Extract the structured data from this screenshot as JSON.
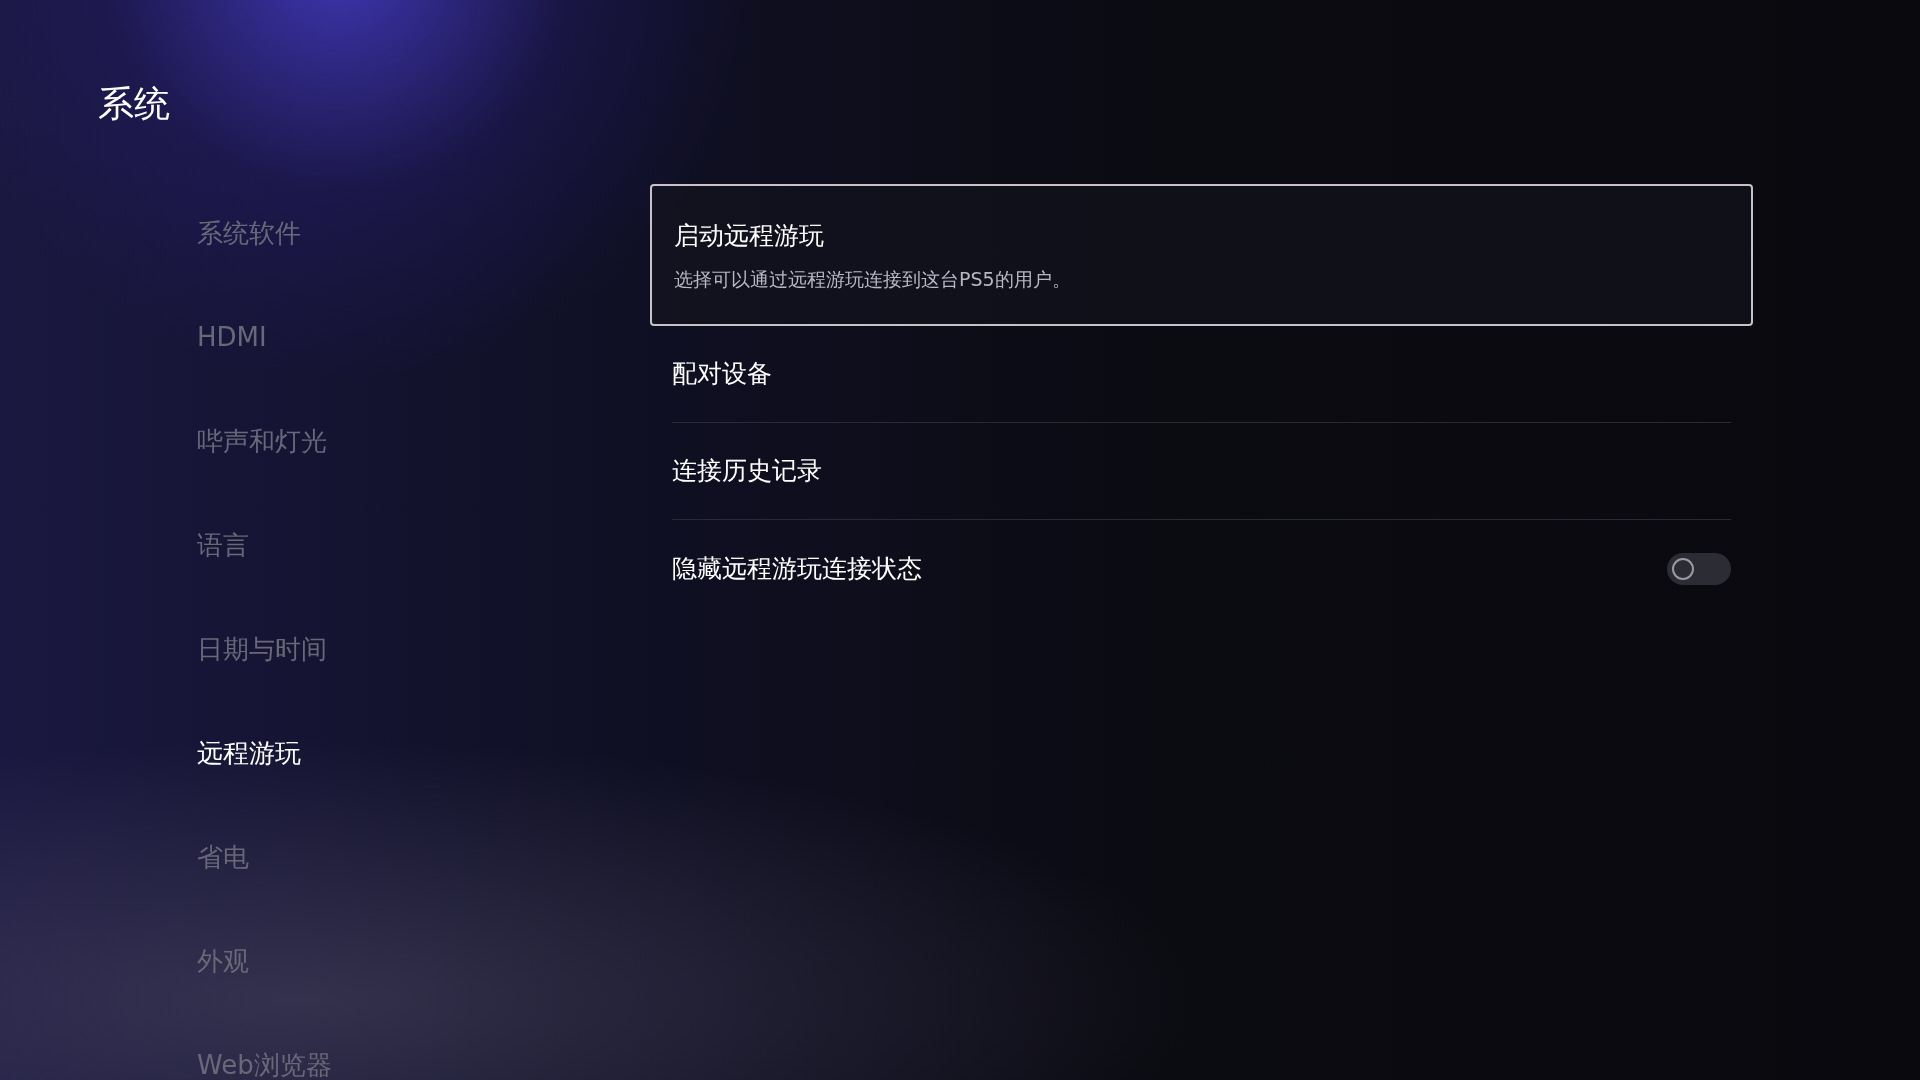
{
  "page_title": "系统",
  "sidebar": {
    "items": [
      {
        "label": "系统软件",
        "selected": false
      },
      {
        "label": "HDMI",
        "selected": false
      },
      {
        "label": "哔声和灯光",
        "selected": false
      },
      {
        "label": "语言",
        "selected": false
      },
      {
        "label": "日期与时间",
        "selected": false
      },
      {
        "label": "远程游玩",
        "selected": true
      },
      {
        "label": "省电",
        "selected": false
      },
      {
        "label": "外观",
        "selected": false
      },
      {
        "label": "Web浏览器",
        "selected": false
      }
    ]
  },
  "settings": [
    {
      "kind": "link",
      "label": "启动远程游玩",
      "description": "选择可以通过远程游玩连接到这台PS5的用户。",
      "focused": true
    },
    {
      "kind": "link",
      "label": "配对设备",
      "focused": false
    },
    {
      "kind": "link",
      "label": "连接历史记录",
      "focused": false
    },
    {
      "kind": "toggle",
      "label": "隐藏远程游玩连接状态",
      "on": false,
      "focused": false
    }
  ]
}
